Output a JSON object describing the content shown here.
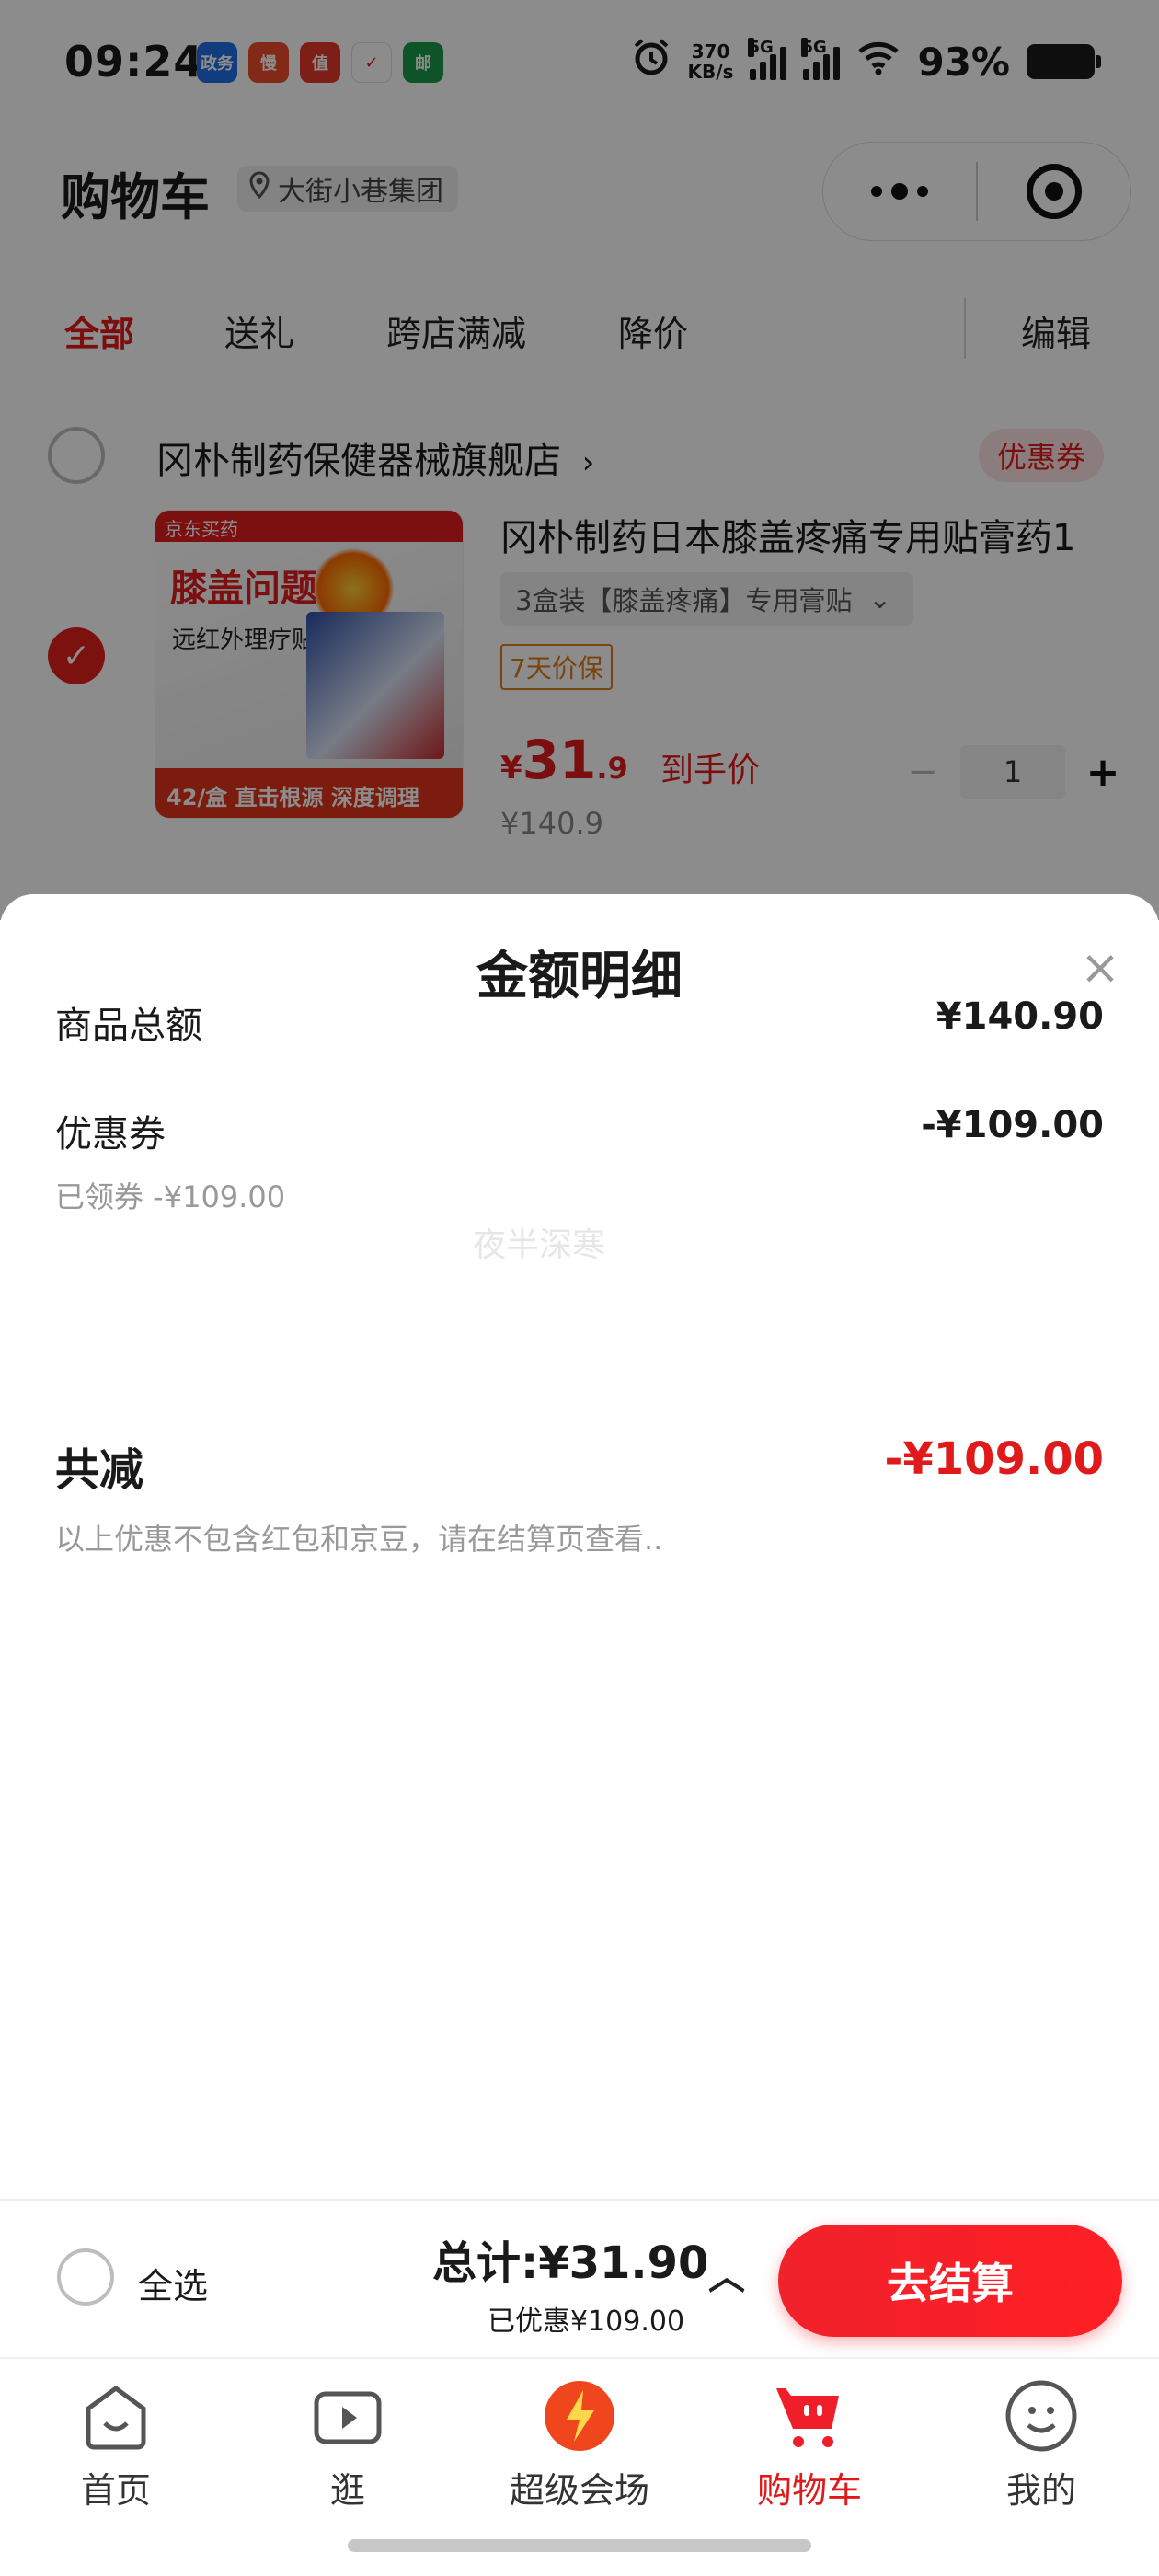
{
  "status_bar": {
    "time": "09:24",
    "notifications": [
      {
        "icon": "zhengwu-app-icon",
        "label": "政务",
        "color": "#1f6fe8"
      },
      {
        "icon": "bargain-app-icon",
        "label": "慢",
        "color": "#ef4b2a"
      },
      {
        "icon": "value-app-icon",
        "label": "值",
        "color": "#e5392a"
      },
      {
        "icon": "arrow-app-icon",
        "label": "✓",
        "color": "#e31b1b"
      },
      {
        "icon": "post-app-icon",
        "label": "邮",
        "color": "#1b9a4a"
      }
    ],
    "net_speed_value": "370",
    "net_speed_unit": "KB/s",
    "signal_1": "5G",
    "signal_2": "5G",
    "battery": "93%"
  },
  "header": {
    "title": "购物车",
    "location": "大街小巷集团"
  },
  "tabs": [
    "全部",
    "送礼",
    "跨店满减",
    "降价"
  ],
  "edit_label": "编辑",
  "shop": {
    "name": "冈朴制药保健器械旗舰店",
    "coupon_tag": "优惠券",
    "item": {
      "image_texts": {
        "brand": "京东买药",
        "headline": "膝盖问题",
        "subline": "远红外理疗贴",
        "footer": "42/盒 直击根源 深度调理"
      },
      "title": "冈朴制药日本膝盖疼痛专用贴膏药1",
      "sku": "3盒装【膝盖疼痛】专用膏贴",
      "price_guard": "7天价保",
      "price_currency": "¥",
      "price_int": "31",
      "price_dec": ".9",
      "price_label": "到手价",
      "original_price": "¥140.9",
      "quantity": "1"
    }
  },
  "sheet": {
    "title": "金额明细",
    "goods_total_label": "商品总额",
    "goods_total_value": "¥140.90",
    "coupon_label": "优惠券",
    "coupon_value": "-¥109.00",
    "coupon_sub": "已领券 -¥109.00",
    "watermark": "夜半深寒",
    "total_discount_label": "共减",
    "total_discount_value": "-¥109.00",
    "note": "以上优惠不包含红包和京豆，请在结算页查看.."
  },
  "checkout": {
    "select_all": "全选",
    "total": "总计:¥31.90",
    "saved": "已优惠¥109.00",
    "button": "去结算"
  },
  "tab_bar": [
    {
      "label": "首页",
      "icon": "home-icon"
    },
    {
      "label": "逛",
      "icon": "video-icon"
    },
    {
      "label": "超级会场",
      "icon": "super-venue-icon"
    },
    {
      "label": "购物车",
      "icon": "cart-icon",
      "active": true
    },
    {
      "label": "我的",
      "icon": "profile-icon"
    }
  ],
  "colors": {
    "accent": "#e01a1a",
    "checkout_button": "#f0222c",
    "muted_text": "#999999"
  }
}
